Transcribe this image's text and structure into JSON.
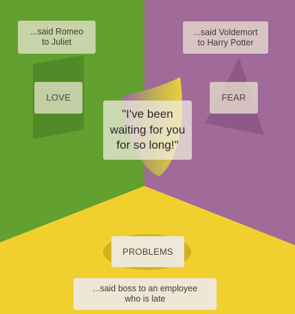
{
  "colors": {
    "green": "#62a030",
    "purple": "#a06a99",
    "yellow": "#f1cf2e",
    "box": "#eee7d6"
  },
  "center_quote": {
    "line1": "\"I've been",
    "line2": "waiting for you",
    "line3": "for so long!\""
  },
  "love": {
    "label": "LOVE",
    "said_line1": "...said Romeo",
    "said_line2": "to Juliet"
  },
  "fear": {
    "label": "FEAR",
    "said_line1": "...said Voldemort",
    "said_line2": "to Harry Potter"
  },
  "problems": {
    "label": "PROBLEMS",
    "said_line1": "...said boss to an employee",
    "said_line2": "who is late"
  }
}
